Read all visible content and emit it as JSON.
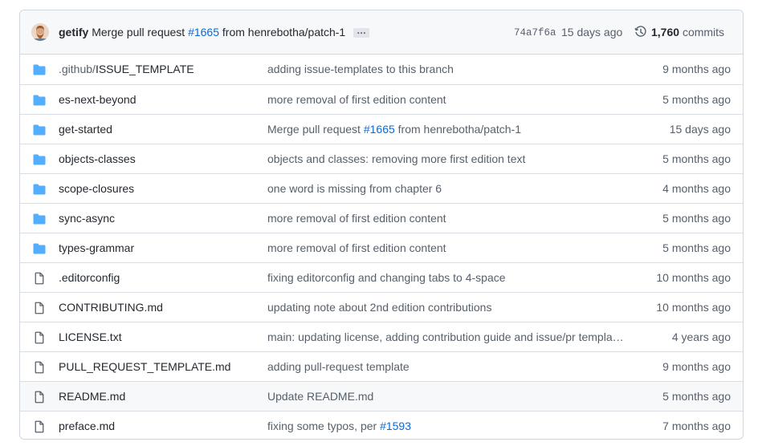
{
  "latest_commit": {
    "author": "getify",
    "message_prefix": "Merge pull request",
    "pr_link": "#1665",
    "message_suffix": "from henrebotha/patch-1",
    "ellipsis": "…",
    "sha": "74a7f6a",
    "age": "15 days ago",
    "commits_count": "1,760",
    "commits_label": "commits"
  },
  "files": [
    {
      "type": "folder",
      "icon": "folder-icon",
      "name_dim": ".github/",
      "name": "ISSUE_TEMPLATE",
      "msg": "adding issue-templates to this branch",
      "msg_link": "",
      "msg_after": "",
      "age": "9 months ago"
    },
    {
      "type": "folder",
      "icon": "folder-icon",
      "name_dim": "",
      "name": "es-next-beyond",
      "msg": "more removal of first edition content",
      "msg_link": "",
      "msg_after": "",
      "age": "5 months ago"
    },
    {
      "type": "folder",
      "icon": "folder-icon",
      "name_dim": "",
      "name": "get-started",
      "msg": "Merge pull request ",
      "msg_link": "#1665",
      "msg_after": " from henrebotha/patch-1",
      "age": "15 days ago"
    },
    {
      "type": "folder",
      "icon": "folder-icon",
      "name_dim": "",
      "name": "objects-classes",
      "msg": "objects and classes: removing more first edition text",
      "msg_link": "",
      "msg_after": "",
      "age": "5 months ago"
    },
    {
      "type": "folder",
      "icon": "folder-icon",
      "name_dim": "",
      "name": "scope-closures",
      "msg": "one word is missing from chapter 6",
      "msg_link": "",
      "msg_after": "",
      "age": "4 months ago"
    },
    {
      "type": "folder",
      "icon": "folder-icon",
      "name_dim": "",
      "name": "sync-async",
      "msg": "more removal of first edition content",
      "msg_link": "",
      "msg_after": "",
      "age": "5 months ago"
    },
    {
      "type": "folder",
      "icon": "folder-icon",
      "name_dim": "",
      "name": "types-grammar",
      "msg": "more removal of first edition content",
      "msg_link": "",
      "msg_after": "",
      "age": "5 months ago"
    },
    {
      "type": "file",
      "icon": "file-icon",
      "name_dim": "",
      "name": ".editorconfig",
      "msg": "fixing editorconfig and changing tabs to 4-space",
      "msg_link": "",
      "msg_after": "",
      "age": "10 months ago"
    },
    {
      "type": "file",
      "icon": "file-icon",
      "name_dim": "",
      "name": "CONTRIBUTING.md",
      "msg": "updating note about 2nd edition contributions",
      "msg_link": "",
      "msg_after": "",
      "age": "10 months ago"
    },
    {
      "type": "file",
      "icon": "file-icon",
      "name_dim": "",
      "name": "LICENSE.txt",
      "msg": "main: updating license, adding contribution guide and issue/pr templa…",
      "msg_link": "",
      "msg_after": "",
      "age": "4 years ago"
    },
    {
      "type": "file",
      "icon": "file-icon",
      "name_dim": "",
      "name": "PULL_REQUEST_TEMPLATE.md",
      "msg": "adding pull-request template",
      "msg_link": "",
      "msg_after": "",
      "age": "9 months ago"
    },
    {
      "type": "file",
      "icon": "file-icon",
      "name_dim": "",
      "name": "README.md",
      "msg": "Update README.md",
      "msg_link": "",
      "msg_after": "",
      "age": "5 months ago",
      "hover": true
    },
    {
      "type": "file",
      "icon": "file-icon",
      "name_dim": "",
      "name": "preface.md",
      "msg": "fixing some typos, per ",
      "msg_link": "#1593",
      "msg_after": "",
      "age": "7 months ago"
    }
  ],
  "colors": {
    "folder": "#54aeff",
    "file_icon": "#57606a",
    "link": "#0969da",
    "border": "#d0d7de"
  }
}
